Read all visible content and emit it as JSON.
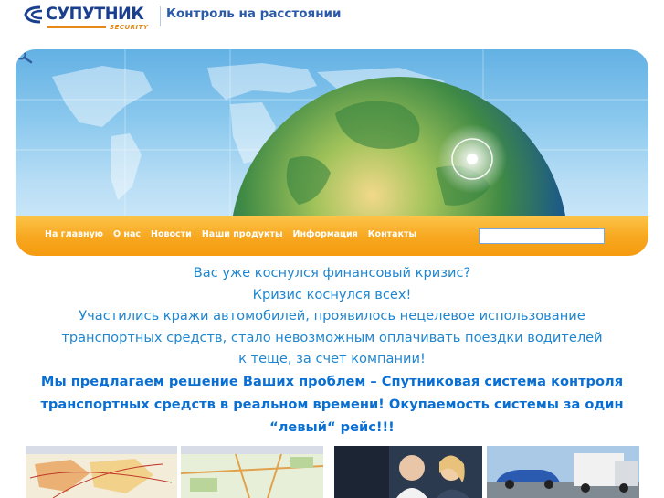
{
  "header": {
    "logo_text": "СУПУТНИК",
    "logo_sub": "SECURITY",
    "tagline": "Контроль на расстоянии"
  },
  "nav": {
    "items": [
      {
        "label": "На главную"
      },
      {
        "label": "О нас"
      },
      {
        "label": "Новости"
      },
      {
        "label": "Наши продукты"
      },
      {
        "label": "Информация"
      },
      {
        "label": "Контакты"
      }
    ]
  },
  "search": {
    "value": "",
    "placeholder": ""
  },
  "content": {
    "lines": [
      "Вас уже коснулся финансовый кризис?",
      "Кризис коснулся всех!",
      "Участились кражи автомобилей, проявилось нецелевое использование",
      "транспортных средств, стало невозможным оплачивать поездки водителей",
      "к теще, за счет компании!"
    ],
    "bold_lines": [
      "Мы предлагаем решение Ваших проблем – Спутниковая система контроля",
      "транспортных средств в реальном времени! Окупаемость системы за один",
      "“левый“ рейс!!!"
    ]
  },
  "colors": {
    "brand": "#1a3f8f",
    "accent": "#f7a71f",
    "text": "#1f86cf",
    "text_bold": "#0a6fd3"
  },
  "icons": [
    "logo-icon",
    "search-icon",
    "arrow-right-icon"
  ]
}
